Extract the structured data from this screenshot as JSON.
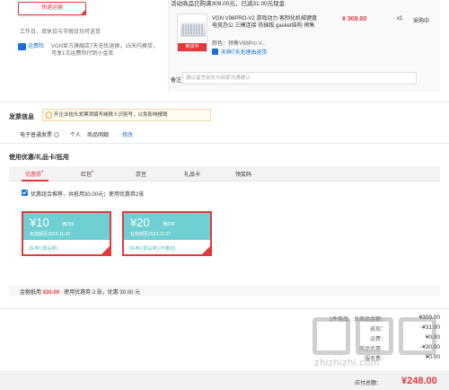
{
  "shipping": {
    "method_button": "快递运输",
    "work_time": "工作日、双休日与节假日均可送货",
    "store_label": "运费险",
    "store_note": "VGN官方旗舰店7天无忧退换，15天内换货，可享1次运费险付到小金库"
  },
  "product": {
    "promo": "活动商品已购满309.00元，已减31.00元现金",
    "title": "VGN V98PRO-V2 游戏动力 客制化机械键盘 电竞办公 三模连接 热插拔 gasket结构 预售",
    "option": "颜色：预售V98Pro V...",
    "service": "天神7天无理由退货",
    "img_tag": "到货中",
    "price": "¥ 309.00",
    "qty": "x1",
    "stock": "采购中",
    "remark_label": "备注：",
    "remark_placeholder": "建议留言前先与商家沟通确认"
  },
  "invoice": {
    "title": "发票信息",
    "tip": "开企业抬头发票须填写纳税人识别号，以免影响报销",
    "type": "电子普通发票",
    "holder": "个人",
    "content": "商品明细",
    "edit": "修改"
  },
  "coupons": {
    "title": "使用优惠/礼品卡/抵用",
    "tabs": [
      "优惠券",
      "红包",
      "京豆",
      "礼品卡",
      "领奖码"
    ],
    "tab_marks": [
      "•",
      "•",
      "",
      "",
      ""
    ],
    "checkbox_text": "优惠组合推荐，共抵用30.00元；使用优惠券2张",
    "items": [
      {
        "amount": "¥10",
        "cond": "满299",
        "valid": "有效期至2023-11-30",
        "tags": "[东券] [限品类]"
      },
      {
        "amount": "¥20",
        "cond": "满208",
        "valid": "有效期至2023-11-07",
        "tags": "[东券] [限品类] [可叠加]"
      }
    ],
    "summary_label": "金额抵用",
    "summary_amount": "¥30.00",
    "summary_detail": "使用优惠券 2 张，优惠 30.00 元"
  },
  "totals": {
    "rows": [
      {
        "label": "1件商品，总商品金额：",
        "value": "¥309.00"
      },
      {
        "label": "返现：",
        "value": "-¥31.00"
      },
      {
        "label": "运费：",
        "value": "¥0.00"
      },
      {
        "label": "商品优惠：",
        "value": "-¥30.00"
      },
      {
        "label": "服务费：",
        "value": "¥0.00"
      }
    ],
    "pay_label": "应付总额：",
    "pay_amount": "¥248.00"
  },
  "watermark": {
    "text": "zhizhizhi.com"
  },
  "colors": {
    "accent": "#e4393c",
    "link": "#1a6fd4",
    "coupon": "#6fcfd3"
  }
}
